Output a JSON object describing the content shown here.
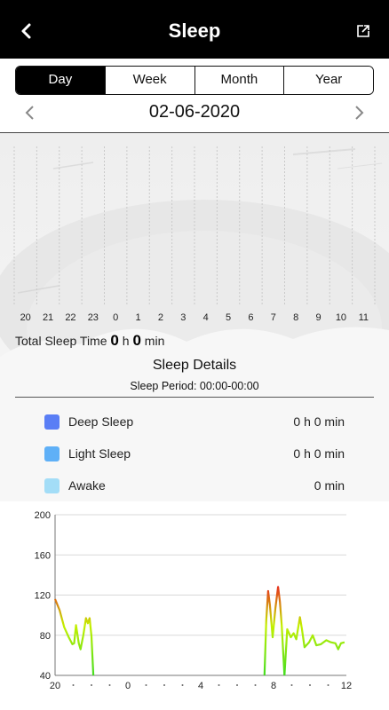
{
  "header": {
    "title": "Sleep",
    "back_icon": "chevron-left-icon",
    "share_icon": "share-icon"
  },
  "tabs": [
    {
      "label": "Day",
      "active": true
    },
    {
      "label": "Week",
      "active": false
    },
    {
      "label": "Month",
      "active": false
    },
    {
      "label": "Year",
      "active": false
    }
  ],
  "date": {
    "value": "02-06-2020"
  },
  "hours": [
    "20",
    "21",
    "22",
    "23",
    "0",
    "1",
    "2",
    "3",
    "4",
    "5",
    "6",
    "7",
    "8",
    "9",
    "10",
    "11"
  ],
  "total": {
    "label": "Total Sleep Time",
    "hours": "0",
    "h_unit": "h",
    "minutes": "0",
    "min_unit": "min"
  },
  "details": {
    "title": "Sleep Details",
    "period": "Sleep Period: 00:00-00:00"
  },
  "legend": [
    {
      "label": "Deep Sleep",
      "value": "0 h 0 min",
      "color": "#5a7ef5"
    },
    {
      "label": "Light Sleep",
      "value": "0 h 0 min",
      "color": "#5fb0f7"
    },
    {
      "label": "Awake",
      "value": "0 min",
      "color": "#a3ddf7"
    }
  ],
  "chart_data": {
    "type": "line",
    "ylim": [
      40,
      200
    ],
    "yticks": [
      "200",
      "160",
      "120",
      "80",
      "40"
    ],
    "xticks": [
      "20",
      "0",
      "4",
      "8",
      "12"
    ],
    "xlim": [
      20,
      36
    ],
    "segments": [
      [
        [
          20.0,
          116
        ],
        [
          20.25,
          105
        ],
        [
          20.5,
          88
        ],
        [
          20.75,
          78
        ],
        [
          20.95,
          71
        ],
        [
          21.05,
          72
        ],
        [
          21.15,
          90
        ],
        [
          21.3,
          72
        ],
        [
          21.4,
          66
        ],
        [
          21.55,
          80
        ],
        [
          21.7,
          97
        ],
        [
          21.8,
          92
        ],
        [
          21.9,
          97
        ],
        [
          22.0,
          79
        ],
        [
          22.1,
          40
        ]
      ],
      [
        [
          31.5,
          40
        ],
        [
          31.6,
          95
        ],
        [
          31.7,
          124
        ],
        [
          31.8,
          110
        ],
        [
          31.95,
          78
        ],
        [
          32.1,
          107
        ],
        [
          32.25,
          128
        ],
        [
          32.35,
          113
        ],
        [
          32.45,
          90
        ],
        [
          32.6,
          40
        ]
      ],
      [
        [
          32.6,
          40
        ],
        [
          32.75,
          86
        ],
        [
          32.95,
          78
        ],
        [
          33.1,
          82
        ],
        [
          33.25,
          76
        ],
        [
          33.45,
          98
        ],
        [
          33.55,
          87
        ],
        [
          33.7,
          68
        ],
        [
          33.95,
          73
        ],
        [
          34.15,
          80
        ],
        [
          34.35,
          70
        ],
        [
          34.6,
          71
        ],
        [
          34.9,
          75
        ],
        [
          35.15,
          73
        ],
        [
          35.4,
          72
        ],
        [
          35.55,
          66
        ],
        [
          35.7,
          72
        ],
        [
          35.9,
          73
        ]
      ]
    ],
    "line_colors": {
      "low": "#44dd22",
      "mid": "#c4f000",
      "high": "#e82a1f"
    }
  }
}
